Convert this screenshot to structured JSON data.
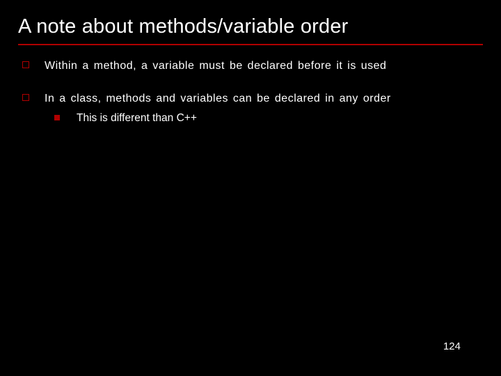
{
  "title": "A note about methods/variable order",
  "bullets": [
    {
      "text": "Within a method, a variable must be declared before it is used"
    },
    {
      "text": "In a class, methods and variables can be declared in any order",
      "sub": [
        {
          "text": "This is different than C++"
        }
      ]
    }
  ],
  "pageNumber": "124"
}
